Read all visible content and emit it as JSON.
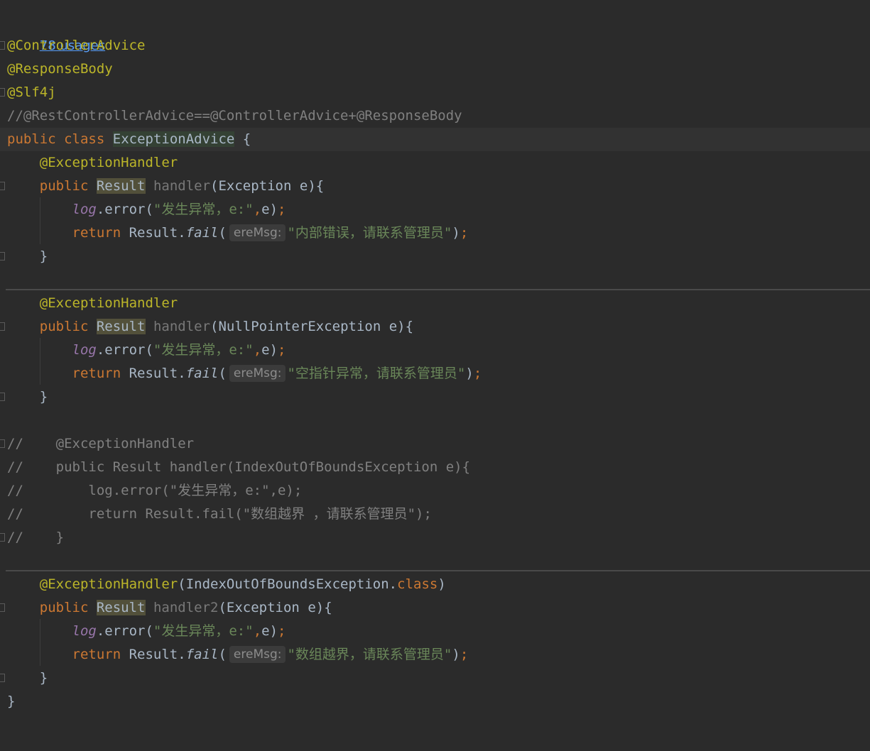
{
  "editor": {
    "usages_label": "78 usages",
    "annotations": {
      "controller_advice": "@ControllerAdvice",
      "response_body": "@ResponseBody",
      "slf4j": "@Slf4j",
      "exception_handler": "@ExceptionHandler"
    },
    "comment_rest": "//@RestControllerAdvice==@ControllerAdvice+@ResponseBody",
    "class_decl": {
      "public": "public",
      "class": "class",
      "name": "ExceptionAdvice",
      "brace": " {"
    },
    "hint_label": "ereMsg:",
    "methods": [
      {
        "param_type": "Exception",
        "method_name": "handler",
        "log_string": "\"发生异常，e:\"",
        "fail_string": "\"内部错误，请联系管理员\""
      },
      {
        "param_type": "NullPointerException",
        "method_name": "handler",
        "log_string": "\"发生异常，e:\"",
        "fail_string": "\"空指针异常，请联系管理员\""
      },
      {
        "param_type": "Exception",
        "method_name": "handler2",
        "annotation_arg": "IndexOutOfBoundsException",
        "log_string": "\"发生异常，e:\"",
        "fail_string": "\"数组越界，请联系管理员\""
      }
    ],
    "commented_block": [
      "//    @ExceptionHandler",
      "//    public Result handler(IndexOutOfBoundsException e){",
      "//        log.error(\"发生异常，e:\",e);",
      "//        return Result.fail(\"数组越界 ，请联系管理员\");",
      "//    }"
    ],
    "tokens": {
      "public": "public",
      "result": "Result",
      "log": "log",
      "error": ".error(",
      "return": "return",
      "result_fail": "Result.",
      "fail": "fail",
      "class_kw": "class",
      "close_brace": "}"
    }
  }
}
